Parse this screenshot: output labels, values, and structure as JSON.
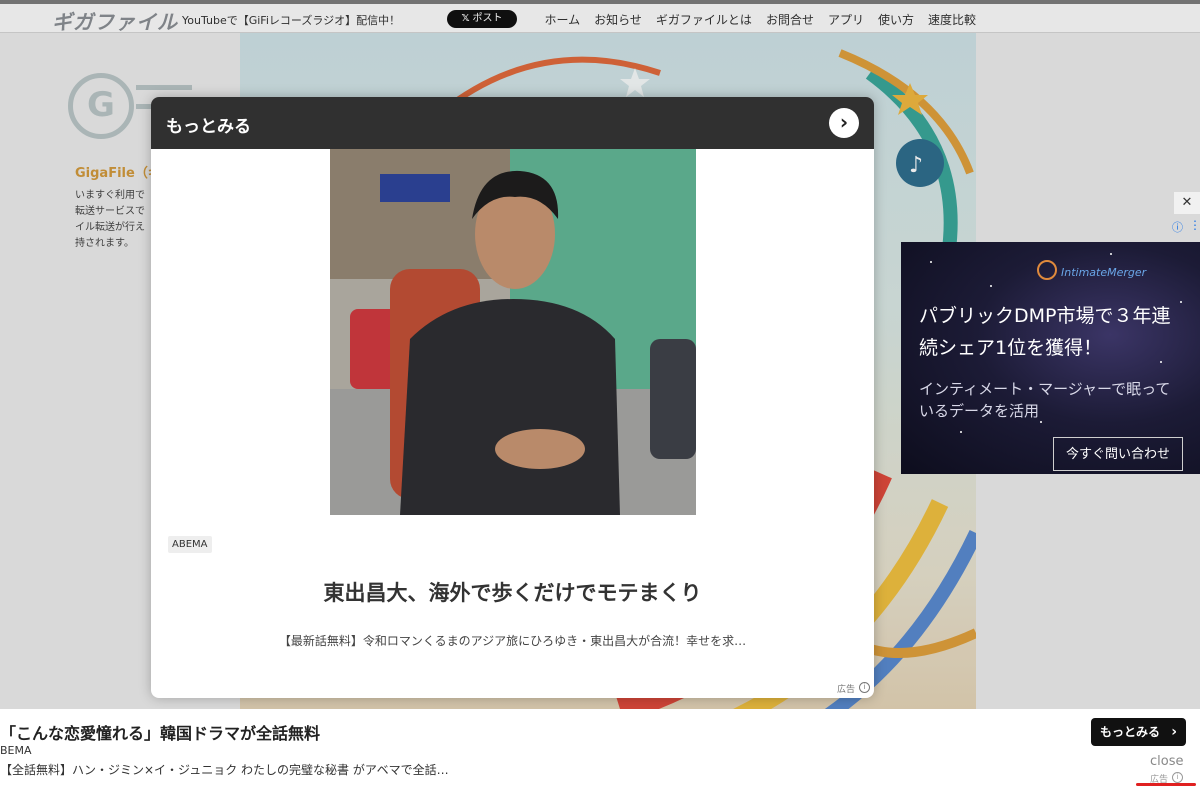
{
  "header": {
    "logo": "ギガファイル",
    "notice": "YouTubeで【GiFiレコーズラジオ】配信中！",
    "post_button": "ポスト",
    "nav": [
      "ホーム",
      "お知らせ",
      "ギガファイルとは",
      "お問合せ",
      "アプリ",
      "使い方",
      "速度比較"
    ]
  },
  "page": {
    "site_name": "GigaFile（ギ",
    "site_desc": [
      "いますぐ利用で",
      "転送サービスで",
      "イル転送が行え",
      "持されます。"
    ]
  },
  "right_ad": {
    "close_icon": "close-x-icon",
    "brand": "IntimateMerger",
    "headline": "パブリックDMP市場で３年連続シェア1位を獲得！",
    "subtext": "インティメート・マージャーで眠っているデータを活用",
    "cta": "今すぐ問い合わせ"
  },
  "modal": {
    "title": "もっとみる",
    "source": "ABEMA",
    "headline": "東出昌大、海外で歩くだけでモテまくり",
    "description": "【最新話無料】令和ロマンくるまのアジア旅にひろゆき・東出昌大が合流！幸せを求…",
    "ad_label": "広告",
    "colors": {
      "header_bg": "#303030",
      "body_bg": "#ffffff"
    }
  },
  "bottom_ad": {
    "title": "「こんな恋愛憧れる」韓国ドラマが全話無料",
    "source": "BEMA",
    "description": "【全話無料】ハン・ジミン×イ・ジュニョク わたしの完璧な秘書 がアベマで全話…",
    "more_button": "もっとみる",
    "close": "close",
    "ad_label": "広告",
    "accent_color": "#e02020"
  }
}
